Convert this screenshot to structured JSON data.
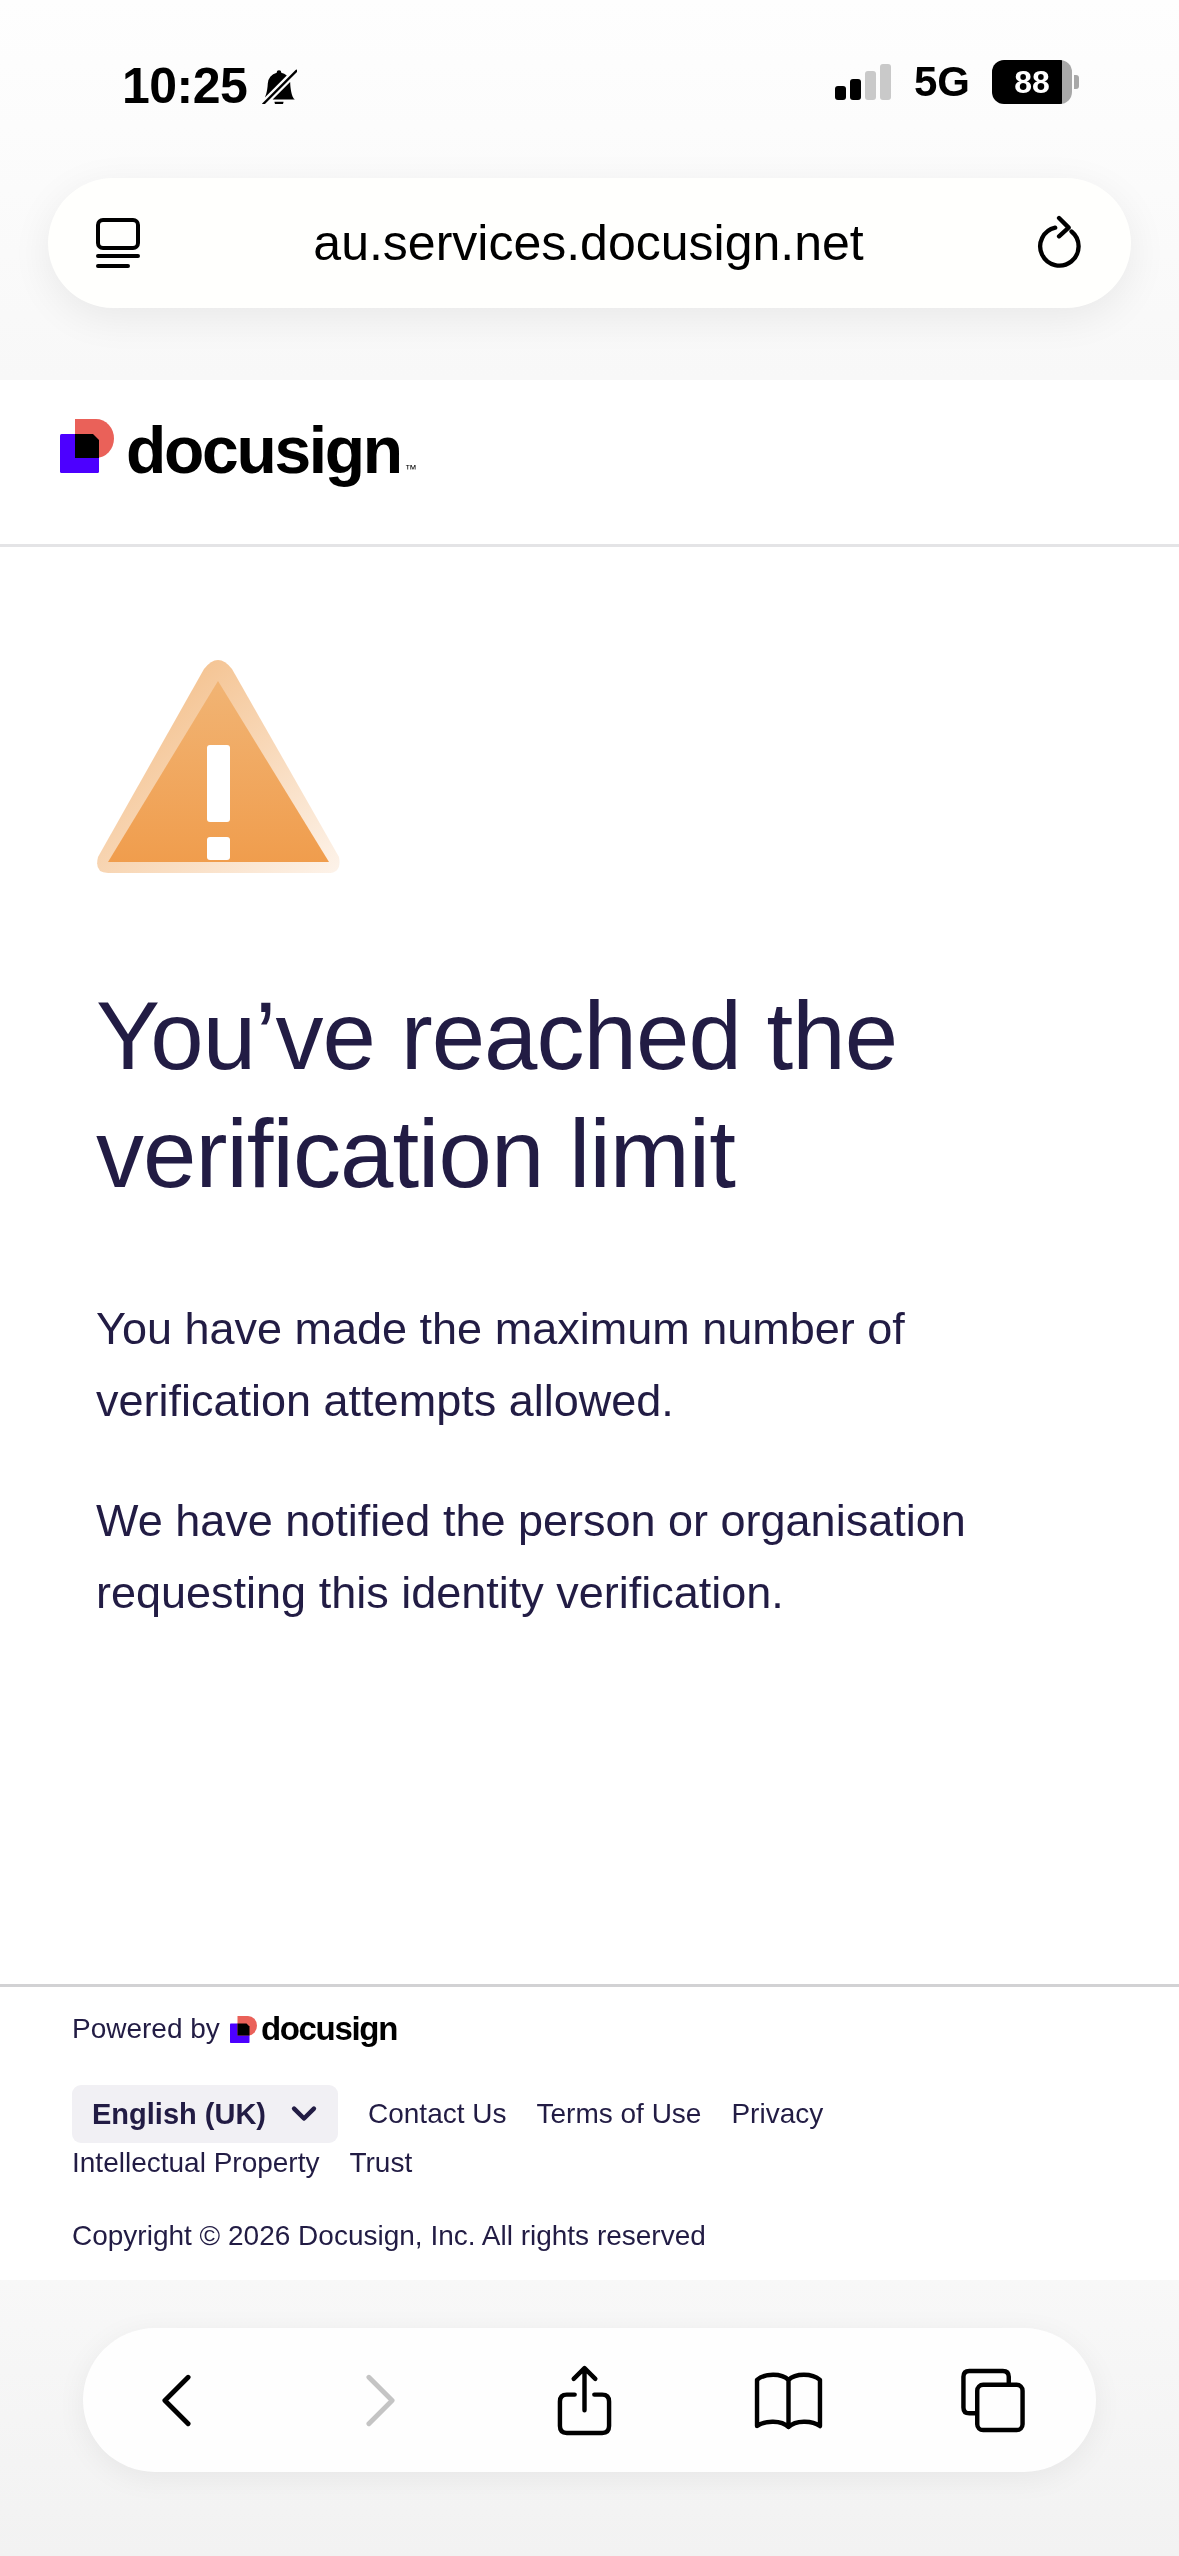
{
  "status_bar": {
    "time": "10:25",
    "silent": true,
    "network": "5G",
    "battery": "88"
  },
  "address_bar": {
    "url": "au.services.docusign.net"
  },
  "header": {
    "logo": {
      "wordmark": "docusign",
      "trademark": "™"
    }
  },
  "message": {
    "title": "You’ve reached the verification limit",
    "paragraphs": [
      "You have made the maximum number of verification attempts allowed.",
      "We have notified the person or organisation requesting this identity verification."
    ]
  },
  "footer": {
    "powered_by": "Powered by",
    "logo": {
      "wordmark": "docusign"
    },
    "language": "English (UK)",
    "links": [
      "Contact Us",
      "Terms of Use",
      "Privacy",
      "Intellectual Property",
      "Trust"
    ],
    "copyright": "Copyright © 2026 Docusign, Inc. All rights reserved"
  },
  "toolbar": [
    {
      "kind": "back",
      "disabled": false
    },
    {
      "kind": "forward",
      "disabled": true
    },
    {
      "kind": "share",
      "disabled": false
    },
    {
      "kind": "bookmarks",
      "disabled": false
    },
    {
      "kind": "tabs",
      "disabled": false
    }
  ]
}
